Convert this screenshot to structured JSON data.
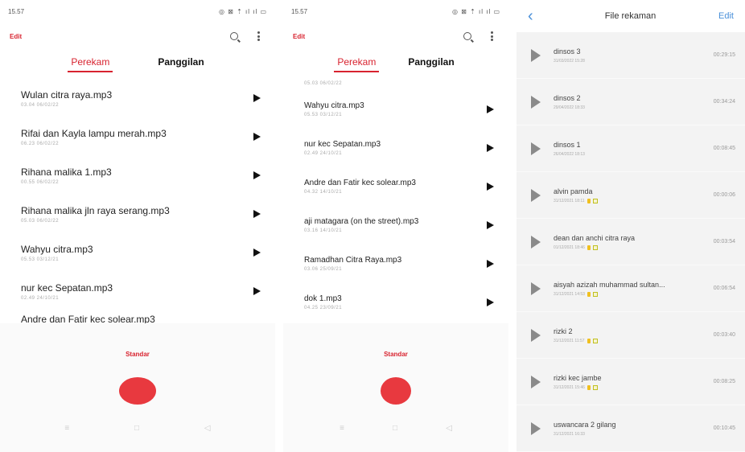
{
  "phone1": {
    "status": {
      "time": "15.57",
      "icons": "◎ ⊠ ⇡ ıl ıl ▭"
    },
    "edit_label": "Edit",
    "tabs": [
      {
        "label": "Perekam"
      },
      {
        "label": "Panggilan"
      }
    ],
    "recordings": [
      {
        "name": "Wulan citra raya.mp3",
        "meta": "03.04  06/02/22"
      },
      {
        "name": "Rifai dan Kayla lampu merah.mp3",
        "meta": "06.23  06/02/22"
      },
      {
        "name": "Rihana malika 1.mp3",
        "meta": "00.55  06/02/22"
      },
      {
        "name": "Rihana malika jln raya serang.mp3",
        "meta": "05.03  06/02/22"
      },
      {
        "name": "Wahyu citra.mp3",
        "meta": "05.53  03/12/21"
      },
      {
        "name": "nur kec Sepatan.mp3",
        "meta": "02.49  24/10/21"
      }
    ],
    "partial_item": "Andre dan Fatir kec solear.mp3",
    "mode_label": "Standar"
  },
  "phone2": {
    "status": {
      "time": "15.57",
      "icons": "◎ ⊠ ⇡ ıl ıl ▭"
    },
    "edit_label": "Edit",
    "tabs": [
      {
        "label": "Perekam"
      },
      {
        "label": "Panggilan"
      }
    ],
    "partial_meta": "05.03  06/02/22",
    "recordings": [
      {
        "name": "Wahyu citra.mp3",
        "meta": "05.53  03/12/21"
      },
      {
        "name": "nur kec Sepatan.mp3",
        "meta": "02.49  24/10/21"
      },
      {
        "name": "Andre dan Fatir kec solear.mp3",
        "meta": "04.32  14/10/21"
      },
      {
        "name": "aji matagara (on the street).mp3",
        "meta": "03.16  14/10/21"
      },
      {
        "name": "Ramadhan Citra Raya.mp3",
        "meta": "03.06  25/09/21"
      },
      {
        "name": "dok 1.mp3",
        "meta": "04.25  23/09/21"
      }
    ],
    "mode_label": "Standar"
  },
  "phone3": {
    "title": "File rekaman",
    "edit_label": "Edit",
    "files": [
      {
        "name": "dinsos 3",
        "date": "31/03/2022 15:28",
        "duration": "00:29:15",
        "badges": false
      },
      {
        "name": "dinsos 2",
        "date": "29/04/2022 18:33",
        "duration": "00:34:24",
        "badges": false
      },
      {
        "name": "dinsos 1",
        "date": "26/04/2022 18:13",
        "duration": "00:08:45",
        "badges": false
      },
      {
        "name": "alvin pamda",
        "date": "31/12/2021 18:11",
        "duration": "00:00:06",
        "badges": true
      },
      {
        "name": "dean dan anchi citra raya",
        "date": "01/12/2021 18:46",
        "duration": "00:03:54",
        "badges": true
      },
      {
        "name": "aisyah azizah muhammad sultan...",
        "date": "31/12/2021 14:53",
        "duration": "00:06:54",
        "badges": true
      },
      {
        "name": "rizki 2",
        "date": "31/12/2021 11:57",
        "duration": "00:03:40",
        "badges": true
      },
      {
        "name": "rizki kec jambe",
        "date": "31/12/2021 15:46",
        "duration": "00:08:25",
        "badges": true
      },
      {
        "name": "uswancara 2 gilang",
        "date": "31/12/2021 16:33",
        "duration": "00:10:45",
        "badges": false
      }
    ]
  }
}
